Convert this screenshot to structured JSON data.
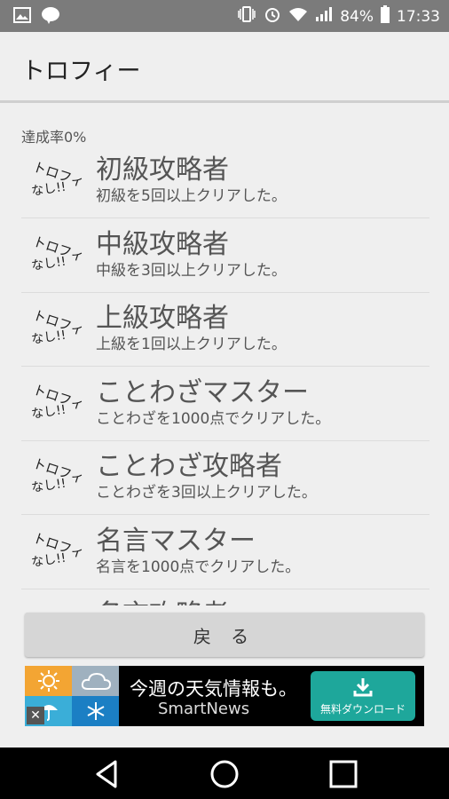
{
  "status_bar": {
    "battery": "84%",
    "time": "17:33"
  },
  "app_bar": {
    "title": "トロフィー"
  },
  "achievement_rate": "達成率0%",
  "trophies": [
    {
      "title": "初級攻略者",
      "description": "初級を5回以上クリアした。"
    },
    {
      "title": "中級攻略者",
      "description": "中級を3回以上クリアした。"
    },
    {
      "title": "上級攻略者",
      "description": "上級を1回以上クリアした。"
    },
    {
      "title": "ことわざマスター",
      "description": "ことわざを1000点でクリアした。"
    },
    {
      "title": "ことわざ攻略者",
      "description": "ことわざを3回以上クリアした。"
    },
    {
      "title": "名言マスター",
      "description": "名言を1000点でクリアした。"
    },
    {
      "title": "名言攻略者",
      "description": ""
    }
  ],
  "trophy_icon_text": {
    "line1": "トロフィー",
    "line2": "なし!!"
  },
  "back_button": {
    "label": "戻 る"
  },
  "ad": {
    "headline": "今週の天気情報も。",
    "brand": "SmartNews",
    "download_label": "無料ダウンロード"
  },
  "colors": {
    "status_bar": "#7b7b7b",
    "background": "#efefef",
    "ad_button": "#1ea79b"
  }
}
